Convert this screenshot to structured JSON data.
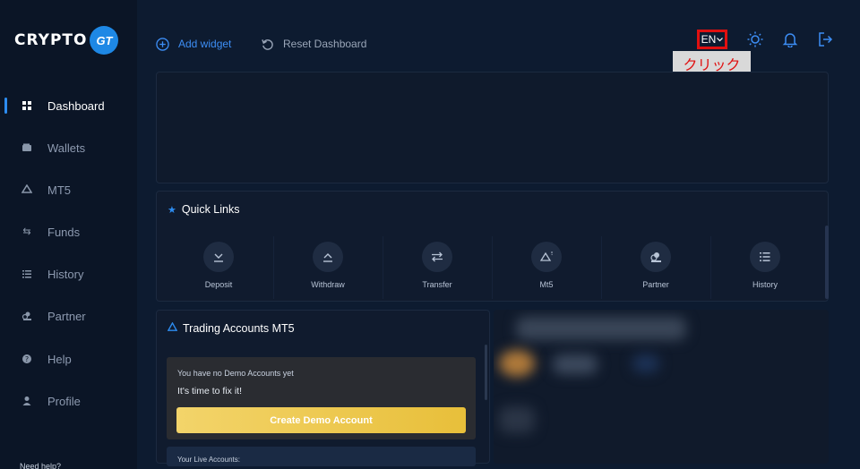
{
  "brand": {
    "name": "CRYPTO",
    "badge": "GT"
  },
  "sidebar": {
    "items": [
      {
        "label": "Dashboard",
        "icon": "grid-icon",
        "active": true
      },
      {
        "label": "Wallets",
        "icon": "wallet-icon"
      },
      {
        "label": "MT5",
        "icon": "mt5-icon"
      },
      {
        "label": "Funds",
        "icon": "transfer-icon"
      },
      {
        "label": "History",
        "icon": "list-icon"
      },
      {
        "label": "Partner",
        "icon": "partner-icon"
      },
      {
        "label": "Help",
        "icon": "help-icon"
      },
      {
        "label": "Profile",
        "icon": "user-icon"
      }
    ],
    "need_help": "Need help?"
  },
  "header": {
    "add_widget": "Add widget",
    "reset_dashboard": "Reset Dashboard",
    "language": "EN",
    "annotation": "クリック"
  },
  "quick_links": {
    "title": "Quick Links",
    "items": [
      {
        "label": "Deposit",
        "icon": "deposit-icon"
      },
      {
        "label": "Withdraw",
        "icon": "withdraw-icon"
      },
      {
        "label": "Transfer",
        "icon": "transfer-icon"
      },
      {
        "label": "Mt5",
        "icon": "mt5-icon"
      },
      {
        "label": "Partner",
        "icon": "partner-icon"
      },
      {
        "label": "History",
        "icon": "history-icon"
      }
    ]
  },
  "trading": {
    "title": "Trading Accounts MT5",
    "demo_empty": "You have no Demo Accounts yet",
    "demo_cta_text": "It's time to fix it!",
    "create_demo": "Create Demo Account",
    "live_accounts": "Your Live Accounts:"
  },
  "colors": {
    "accent": "#2d8cf0",
    "highlight_border": "#e01010",
    "demo_button": "#f3d46a"
  }
}
